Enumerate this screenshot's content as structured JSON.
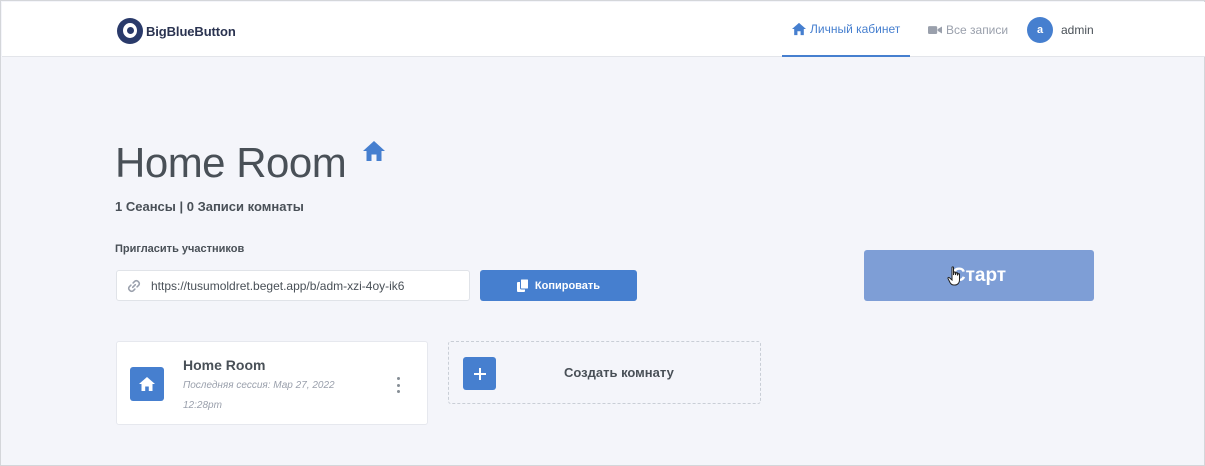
{
  "header": {
    "logo_text": "BigBlueButton",
    "nav": {
      "home_label": "Личный кабинет",
      "recordings_label": "Все записи"
    },
    "user": {
      "avatar_letter": "a",
      "name": "admin"
    }
  },
  "room": {
    "title": "Home Room",
    "stats": "1 Сеансы | 0 Записи комнаты",
    "invite_label": "Пригласить участников",
    "invite_url": "https://tusumoldret.beget.app/b/adm-xzi-4oy-ik6",
    "copy_label": "Копировать",
    "start_label": "Старт"
  },
  "cards": {
    "room_card": {
      "name": "Home Room",
      "last_session": "Последняя сессия: Мар 27, 2022 12:28pm"
    },
    "create_card": {
      "label": "Создать комнату"
    }
  },
  "colors": {
    "accent": "#467fcf",
    "start_button": "#7e9ed6",
    "background": "#f4f5fa"
  },
  "icons": [
    "home-icon",
    "video-camera-icon",
    "link-icon",
    "copy-icon",
    "plus-icon",
    "kebab-menu-icon",
    "hand-cursor-icon"
  ]
}
